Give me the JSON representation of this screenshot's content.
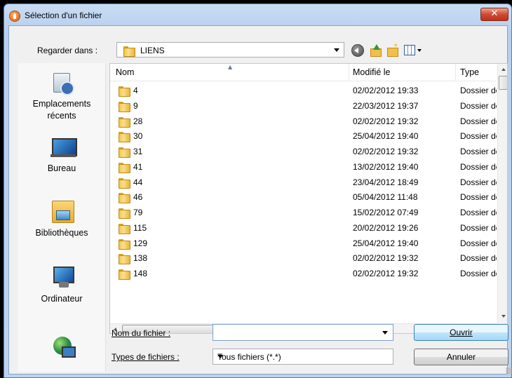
{
  "window": {
    "title": "Sélection d'un fichier",
    "close_label": "✕"
  },
  "toolbar": {
    "lookin_label": "Regarder dans :",
    "lookin_value": "LIENS",
    "icons": [
      "back-icon",
      "up-folder-icon",
      "new-folder-icon",
      "views-menu-icon"
    ]
  },
  "places": [
    {
      "label": "Emplacements récents",
      "icon": "recent-places-icon"
    },
    {
      "label": "Bureau",
      "icon": "desktop-icon"
    },
    {
      "label": "Bibliothèques",
      "icon": "libraries-icon"
    },
    {
      "label": "Ordinateur",
      "icon": "computer-icon"
    },
    {
      "label": "",
      "icon": "network-icon"
    }
  ],
  "columns": {
    "name": "Nom",
    "modified": "Modifié le",
    "type": "Type"
  },
  "files": [
    {
      "name": "4",
      "modified": "02/02/2012 19:33",
      "type": "Dossier de fichiers"
    },
    {
      "name": "9",
      "modified": "22/03/2012 19:37",
      "type": "Dossier de fichiers"
    },
    {
      "name": "28",
      "modified": "02/02/2012 19:32",
      "type": "Dossier de fichiers"
    },
    {
      "name": "30",
      "modified": "25/04/2012 19:40",
      "type": "Dossier de fichiers"
    },
    {
      "name": "31",
      "modified": "02/02/2012 19:32",
      "type": "Dossier de fichiers"
    },
    {
      "name": "41",
      "modified": "13/02/2012 19:40",
      "type": "Dossier de fichiers"
    },
    {
      "name": "44",
      "modified": "23/04/2012 18:49",
      "type": "Dossier de fichiers"
    },
    {
      "name": "46",
      "modified": "05/04/2012 11:48",
      "type": "Dossier de fichiers"
    },
    {
      "name": "79",
      "modified": "15/02/2012 07:49",
      "type": "Dossier de fichiers"
    },
    {
      "name": "115",
      "modified": "20/02/2012 19:26",
      "type": "Dossier de fichiers"
    },
    {
      "name": "129",
      "modified": "25/04/2012 19:40",
      "type": "Dossier de fichiers"
    },
    {
      "name": "138",
      "modified": "02/02/2012 19:32",
      "type": "Dossier de fichiers"
    },
    {
      "name": "148",
      "modified": "02/02/2012 19:32",
      "type": "Dossier de fichiers"
    }
  ],
  "form": {
    "filename_label": "Nom du fichier :",
    "filename_value": "",
    "filetype_label": "Types de fichiers :",
    "filetype_value": "Tous fichiers (*.*)",
    "open_label": "Ouvrir",
    "cancel_label": "Annuler"
  },
  "scrollbar": {
    "grip_label": "III"
  }
}
